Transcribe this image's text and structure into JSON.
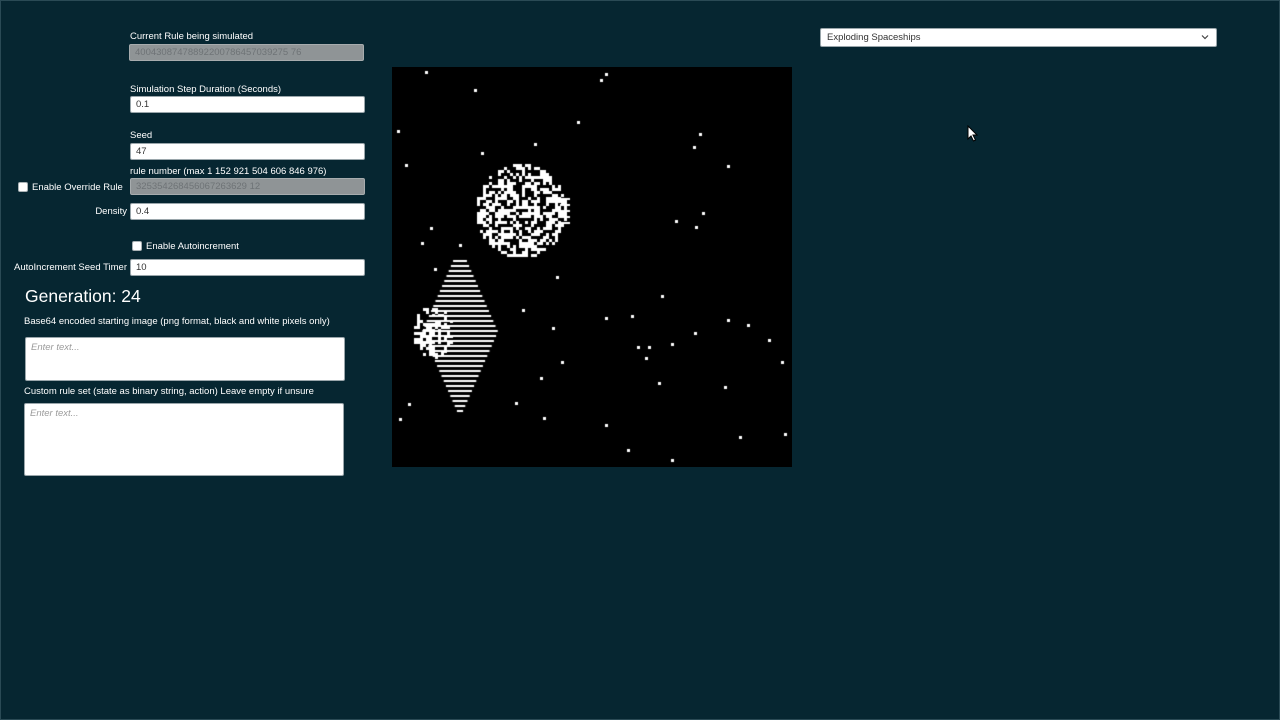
{
  "current_rule": {
    "label": "Current Rule being simulated",
    "value": "40043087478892200786457039275 76"
  },
  "step_duration": {
    "label": "Simulation Step Duration (Seconds)",
    "value": "0.1"
  },
  "seed": {
    "label": "Seed",
    "value": "47"
  },
  "override_rule": {
    "checkbox_label": "Enable Override Rule",
    "checked": false,
    "rule_number_label": "rule number (max 1 152 921 504 606 846 976)",
    "value": "325354268456067263629 12"
  },
  "density": {
    "label": "Density",
    "value": "0.4"
  },
  "autoincrement": {
    "checkbox_label": "Enable Autoincrement",
    "checked": false
  },
  "autoincrement_timer": {
    "label": "AutoIncrement Seed Timer",
    "value": "10"
  },
  "generation": "Generation: 24",
  "starting_image": {
    "label": "Base64 encoded starting image (png format, black and white pixels only)",
    "placeholder": "Enter text..."
  },
  "custom_rules": {
    "label": "Custom rule set (state as binary string, action) Leave empty if unsure",
    "placeholder": "Enter text..."
  },
  "preset_dropdown": {
    "selected": "Exploding Spaceships",
    "icon": "chevron-down-icon"
  },
  "colors": {
    "background": "#062631",
    "cell_alive": "#ffffff",
    "cell_dead": "#000000"
  }
}
